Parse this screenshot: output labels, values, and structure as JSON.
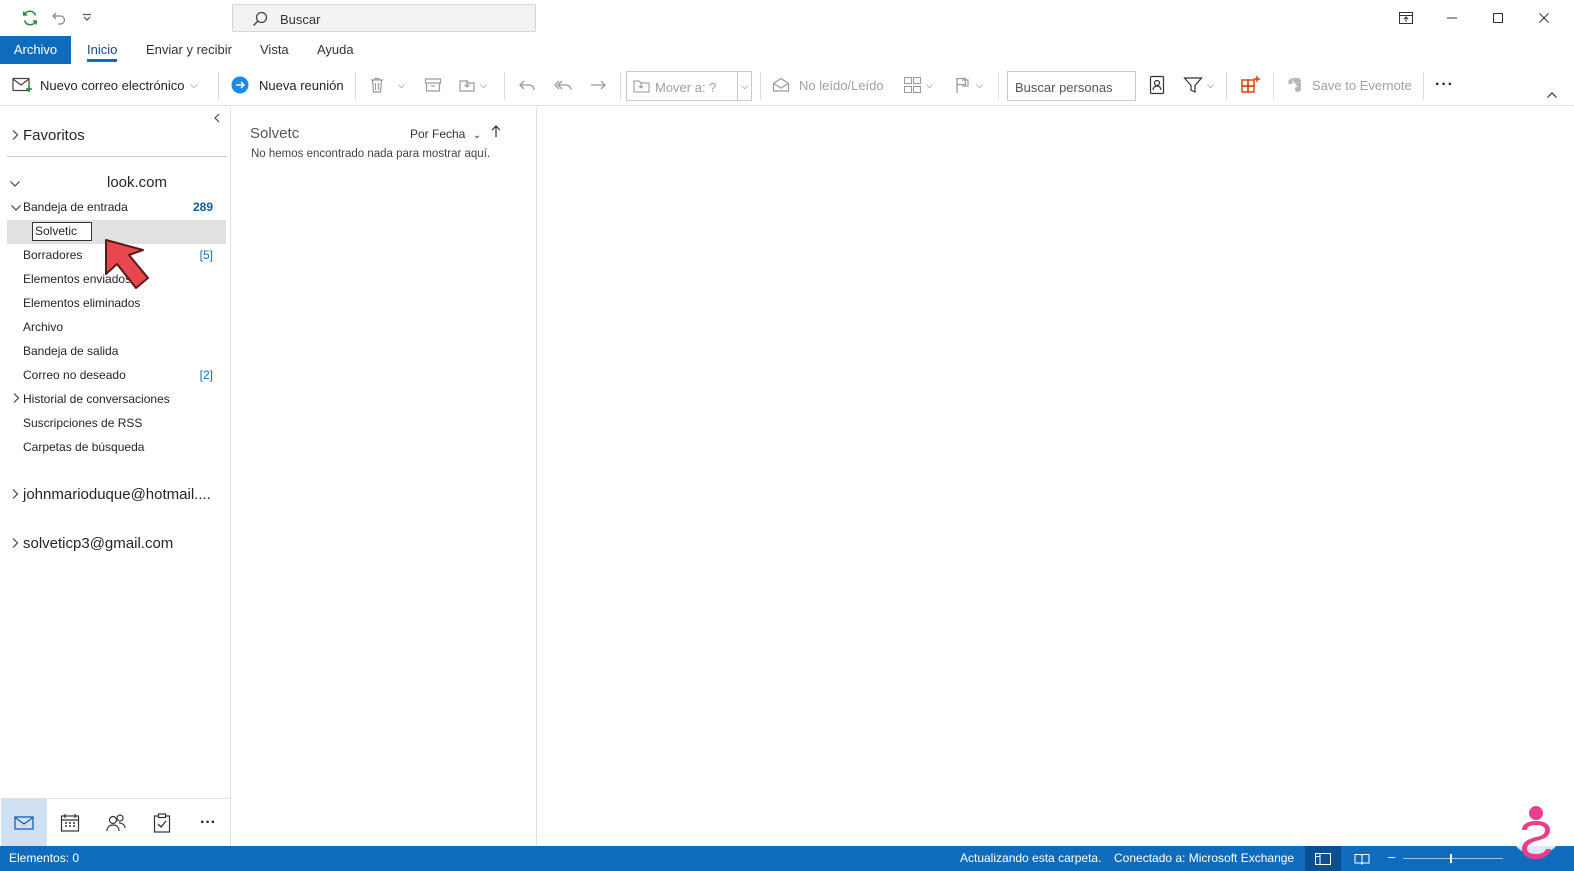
{
  "titlebar": {
    "search_placeholder": "Buscar"
  },
  "menu": {
    "file": "Archivo",
    "tabs": [
      "Inicio",
      "Enviar y recibir",
      "Vista",
      "Ayuda"
    ],
    "active_tab": "Inicio"
  },
  "ribbon": {
    "new_email": "Nuevo correo electrónico",
    "new_meeting": "Nueva reunión",
    "move_to": "Mover a: ?",
    "unread_read": "No leído/Leído",
    "search_people": "Buscar personas",
    "save_evernote": "Save to Evernote",
    "more": "···"
  },
  "folders": {
    "favorites": "Favoritos",
    "account1": "look.com",
    "inbox": "Bandeja de entrada",
    "inbox_count": "289",
    "rename_value": "Solvetic",
    "drafts": "Borradores",
    "drafts_count": "[5]",
    "sent": "Elementos enviados",
    "deleted": "Elementos eliminados",
    "archive": "Archivo",
    "outbox": "Bandeja de salida",
    "junk": "Correo no deseado",
    "junk_count": "[2]",
    "conversation_history": "Historial de conversaciones",
    "rss": "Suscripciones de RSS",
    "search_folders": "Carpetas de búsqueda",
    "account2": "johnmarioduque@hotmail....",
    "account3": "solveticp3@gmail.com"
  },
  "message_list": {
    "folder_title": "Solvetc",
    "sort_label": "Por Fecha",
    "empty_text": "No hemos encontrado nada para mostrar aquí."
  },
  "statusbar": {
    "items": "Elementos: 0",
    "updating": "Actualizando esta carpeta.",
    "connected": "Conectado a: Microsoft Exchange"
  },
  "colors": {
    "accent": "#0f6cbd",
    "selection": "#e1e1e1",
    "annotation_arrow": "#e8474d"
  },
  "icons": [
    "sync-icon",
    "undo-icon",
    "customize-icon",
    "search-icon",
    "ribbon-display-icon",
    "minimize-icon",
    "maximize-icon",
    "close-icon",
    "new-mail-icon",
    "teams-meeting-icon",
    "delete-icon",
    "archive-icon",
    "move-icon",
    "reply-icon",
    "reply-all-icon",
    "forward-icon",
    "envelope-open-icon",
    "categorize-icon",
    "flag-icon",
    "address-book-icon",
    "filter-icon",
    "apps-icon",
    "evernote-icon",
    "mail-icon",
    "calendar-icon",
    "people-icon",
    "tasks-icon"
  ]
}
